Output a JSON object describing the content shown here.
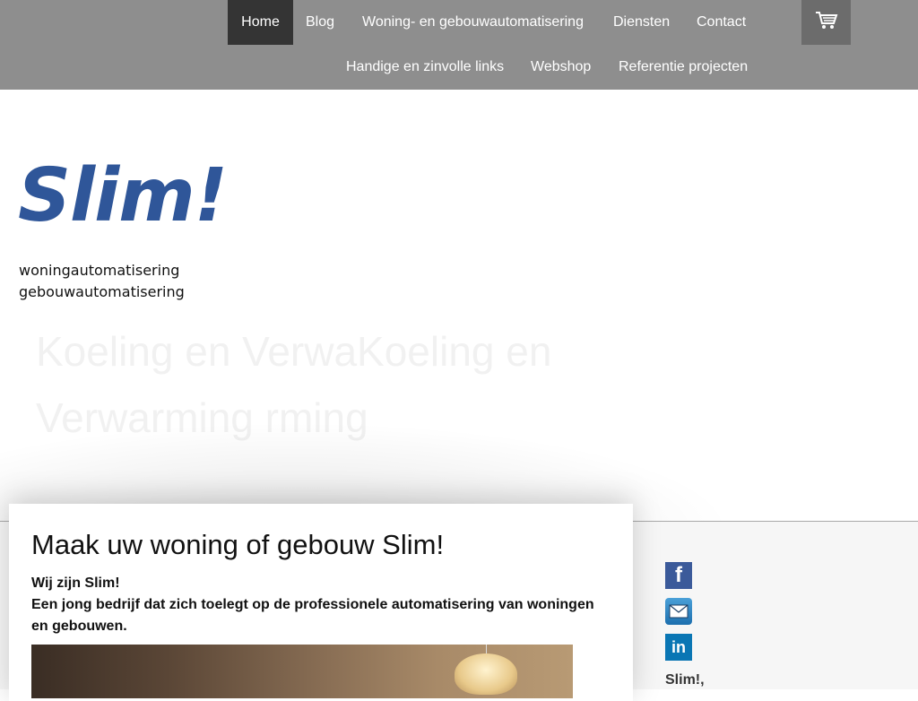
{
  "nav": {
    "row1": [
      "Home",
      "Blog",
      "Woning- en gebouwautomatisering",
      "Diensten",
      "Contact"
    ],
    "row2": [
      "Handige en zinvolle links",
      "Webshop",
      "Referentie projecten"
    ],
    "active": "Home",
    "cart_icon": "shopping-cart-icon"
  },
  "header": {
    "logo": "Slim!",
    "tagline_1": "woningautomatisering",
    "tagline_2": "gebouwautomatisering",
    "hero_line_1": "Koeling en VerwaKoeling en",
    "hero_line_2": "Verwarming rming"
  },
  "main": {
    "title": "Maak uw woning of gebouw Slim!",
    "intro_1": "Wij zijn Slim!",
    "intro_2": "Een jong bedrijf dat zich toelegt op de professionele automatisering van woningen en gebouwen."
  },
  "sidebar": {
    "facebook_icon": "facebook-icon",
    "mail_icon": "mail-icon",
    "linkedin_icon": "linkedin-icon",
    "text": "Slim!,"
  },
  "colors": {
    "nav_bg": "#8e8e8e",
    "nav_active": "#343434",
    "brand_blue": "#2f5699"
  }
}
